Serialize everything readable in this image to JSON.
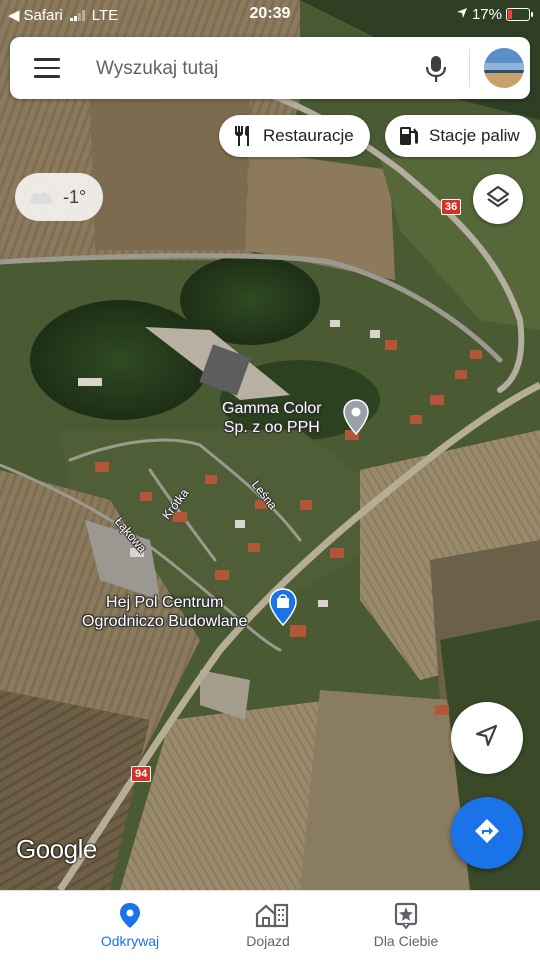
{
  "status_bar": {
    "back_app": "Safari",
    "network": "LTE",
    "time": "20:39",
    "battery": "17%"
  },
  "search": {
    "placeholder": "Wyszukaj tutaj"
  },
  "chips": [
    {
      "label": "Restauracje",
      "icon": "restaurant-icon"
    },
    {
      "label": "Stacje paliw",
      "icon": "gas-station-icon"
    }
  ],
  "weather": {
    "temperature": "-1°",
    "icon": "cloud-icon"
  },
  "map": {
    "places": [
      {
        "name_line1": "Gamma Color",
        "name_line2": "Sp. z oo PPH",
        "icon": "place-pin-icon"
      },
      {
        "name_line1": "Hej Pol Centrum",
        "name_line2": "Ogrodniczo Budowlane",
        "icon": "shopping-pin-icon"
      }
    ],
    "streets": [
      "Leśna",
      "Krótka",
      "Łąkowa"
    ],
    "route_badges": [
      "36",
      "94"
    ],
    "attribution": "Google"
  },
  "bottom_nav": {
    "tabs": [
      {
        "label": "Odkrywaj",
        "icon": "explore-pin-icon",
        "active": true
      },
      {
        "label": "Dojazd",
        "icon": "commute-icon",
        "active": false
      },
      {
        "label": "Dla Ciebie",
        "icon": "for-you-icon",
        "active": false
      }
    ]
  },
  "colors": {
    "accent": "#1a73e8",
    "route_badge": "#d93025"
  }
}
